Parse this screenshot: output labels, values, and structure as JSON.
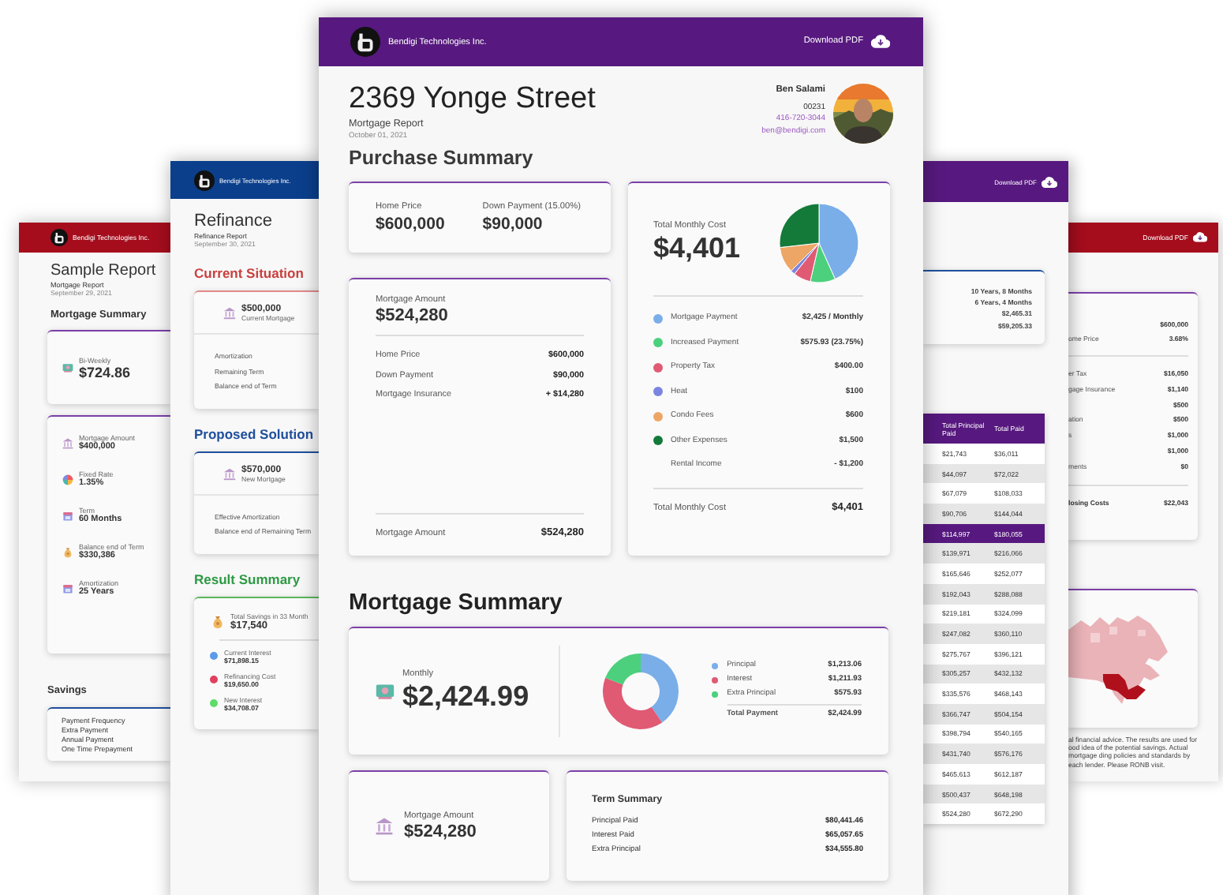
{
  "sample_report": {
    "company": "Bendigi Technologies Inc.",
    "title": "Sample Report",
    "subtitle": "Mortgage Report",
    "date": "September 29, 2021",
    "heading": "Mortgage Summary",
    "payment": {
      "label": "Bi-Weekly",
      "value": "$724.86"
    },
    "details": [
      {
        "label": "Mortgage Amount",
        "value": "$400,000"
      },
      {
        "label": "Fixed Rate",
        "value": "1.35%"
      },
      {
        "label": "Term",
        "value": "60 Months"
      },
      {
        "label": "Balance end of Term",
        "value": "$330,386"
      },
      {
        "label": "Amortization",
        "value": "25 Years"
      }
    ],
    "savings": {
      "heading": "Savings",
      "rows": [
        "Payment Frequency",
        "Extra Payment",
        "Annual Payment",
        "One Time Prepayment"
      ]
    }
  },
  "refinance_report": {
    "company": "Bendigi Technologies Inc.",
    "title": "Refinance",
    "subtitle": "Refinance Report",
    "date": "September 30, 2021",
    "sections": [
      {
        "kind": "current",
        "heading": "Current Situation",
        "amount": "$500,000",
        "amount_label": "Current Mortgage",
        "rows": [
          "Amortization",
          "Remaining Term",
          "Balance end of Term"
        ]
      },
      {
        "kind": "proposed",
        "heading": "Proposed Solution",
        "amount": "$570,000",
        "amount_label": "New Mortgage",
        "rows": [
          "Effective Amortization",
          "Balance end of Remaining Term"
        ]
      }
    ],
    "result": {
      "heading": "Result Summary",
      "label": "Total Savings in 33 Month",
      "value": "$17,540",
      "items": [
        {
          "label": "Current Interest",
          "value": "$71,898.15",
          "color": "#5b9be8"
        },
        {
          "label": "Refinancing Cost",
          "value": "$19,650.00",
          "color": "#e0405e"
        },
        {
          "label": "New Interest",
          "value": "$34,708.07",
          "color": "#5ddc6a"
        }
      ]
    }
  },
  "amortization_report": {
    "download": "Download PDF",
    "summary": [
      "10 Years, 8 Months",
      "6 Years, 4 Months",
      "$2,465.31",
      "$59,205.33"
    ],
    "table": {
      "columns": [
        "Total Principal Paid",
        "Total Paid"
      ],
      "rows": [
        {
          "cells": [
            "$21,743",
            "$36,011"
          ],
          "selected": false
        },
        {
          "cells": [
            "$44,097",
            "$72,022"
          ],
          "selected": false
        },
        {
          "cells": [
            "$67,079",
            "$108,033"
          ],
          "selected": false
        },
        {
          "cells": [
            "$90,706",
            "$144,044"
          ],
          "selected": false
        },
        {
          "cells": [
            "$114,997",
            "$180,055"
          ],
          "selected": true
        },
        {
          "cells": [
            "$139,971",
            "$216,066"
          ],
          "selected": false
        },
        {
          "cells": [
            "$165,646",
            "$252,077"
          ],
          "selected": false
        },
        {
          "cells": [
            "$192,043",
            "$288,088"
          ],
          "selected": false
        },
        {
          "cells": [
            "$219,181",
            "$324,099"
          ],
          "selected": false
        },
        {
          "cells": [
            "$247,082",
            "$360,110"
          ],
          "selected": false
        },
        {
          "cells": [
            "$275,767",
            "$396,121"
          ],
          "selected": false
        },
        {
          "cells": [
            "$305,257",
            "$432,132"
          ],
          "selected": false
        },
        {
          "cells": [
            "$335,576",
            "$468,143"
          ],
          "selected": false
        },
        {
          "cells": [
            "$366,747",
            "$504,154"
          ],
          "selected": false
        },
        {
          "cells": [
            "$398,794",
            "$540,165"
          ],
          "selected": false
        },
        {
          "cells": [
            "$431,740",
            "$576,176"
          ],
          "selected": false
        },
        {
          "cells": [
            "$465,613",
            "$612,187"
          ],
          "selected": false
        },
        {
          "cells": [
            "$500,437",
            "$648,198"
          ],
          "selected": false
        },
        {
          "cells": [
            "$524,280",
            "$672,290"
          ],
          "selected": false
        }
      ]
    }
  },
  "closing_costs_report": {
    "download": "Download PDF",
    "top_rows": [
      {
        "value": "$600,000"
      },
      {
        "label": "ome Price",
        "value": "3.68%"
      }
    ],
    "cost_rows": [
      {
        "label": "er Tax",
        "value": "$16,050"
      },
      {
        "label": "gage Insurance",
        "value": "$1,140"
      },
      {
        "value": "$500"
      },
      {
        "label": "ation",
        "value": "$500"
      },
      {
        "label": "s",
        "value": "$1,000"
      },
      {
        "value": "$1,000"
      },
      {
        "label": "ments",
        "value": "$0"
      }
    ],
    "total": {
      "label": "losing Costs",
      "value": "$22,043"
    },
    "disclaimer": "al financial advice. The results are used for ood idea of the potential savings. Actual mortgage ding policies and standards by each lender. Please RONB visit."
  },
  "main_report": {
    "company": "Bendigi Technologies Inc.",
    "download": "Download PDF",
    "title": "2369 Yonge Street",
    "subtitle": "Mortgage Report",
    "date": "October 01, 2021",
    "agent": {
      "name": "Ben Salami",
      "id": "00231",
      "phone": "416-720-3044",
      "email": "ben@bendigi.com"
    },
    "purchase_summary": {
      "heading": "Purchase Summary",
      "stats": [
        {
          "label": "Home Price",
          "value": "$600,000"
        },
        {
          "label": "Down Payment (15.00%)",
          "value": "$90,000"
        }
      ],
      "mortgage_card": {
        "label": "Mortgage Amount",
        "value": "$524,280",
        "rows": [
          {
            "label": "Home Price",
            "value": "$600,000"
          },
          {
            "label": "Down Payment",
            "value": "$90,000"
          },
          {
            "label": "Mortgage Insurance",
            "value": "+ $14,280"
          }
        ],
        "footer": {
          "label": "Mortgage Amount",
          "value": "$524,280"
        }
      },
      "monthly_cost": {
        "label": "Total Monthly Cost",
        "value": "$4,401",
        "chart_data": {
          "type": "pie",
          "categories": [
            "Mortgage Payment",
            "Increased Payment",
            "Property Tax",
            "Heat",
            "Condo Fees",
            "Other Expenses"
          ],
          "series": [
            {
              "values": [
                43.3,
                10.28,
                7.14,
                1.79,
                10.71,
                26.78
              ]
            }
          ]
        },
        "items": [
          {
            "amount": "$2,425 / Monthly",
            "color": "#7aaee8"
          },
          {
            "amount": "$575.93 (23.75%)",
            "color": "#4cd07d"
          },
          {
            "amount": "$400.00",
            "color": "#e05a74"
          },
          {
            "amount": "$100",
            "color": "#7b84e0"
          },
          {
            "amount": "$600",
            "color": "#eda665"
          },
          {
            "amount": "$1,500",
            "color": "#137a3a"
          }
        ],
        "rental_income": {
          "label": "Rental Income",
          "amount": "- $1,200"
        },
        "total": {
          "label": "Total Monthly Cost",
          "value": "$4,401"
        }
      }
    },
    "mortgage_summary": {
      "heading": "Mortgage Summary",
      "monthly": {
        "label": "Monthly",
        "value": "$2,424.99"
      },
      "chart_data": {
        "type": "donut",
        "categories": [
          "Principal",
          "Interest",
          "Extra Principal"
        ],
        "series": [
          {
            "values": [
              40.42,
              40.39,
              19.19
            ]
          }
        ]
      },
      "items": [
        {
          "amount": "$1,213.06",
          "color": "#7aaee8"
        },
        {
          "amount": "$1,211.93",
          "color": "#e05a74"
        },
        {
          "amount": "$575.93",
          "color": "#4cd07d"
        }
      ],
      "total": {
        "label": "Total Payment",
        "value": "$2,424.99"
      },
      "mortgage_amount": {
        "label": "Mortgage Amount",
        "value": "$524,280"
      },
      "term_summary": {
        "title": "Term Summary",
        "rows": [
          {
            "label": "Principal Paid",
            "value": "$80,441.46"
          },
          {
            "label": "Interest Paid",
            "value": "$65,057.65"
          },
          {
            "label": "Extra Principal",
            "value": "$34,555.80"
          }
        ]
      }
    }
  }
}
